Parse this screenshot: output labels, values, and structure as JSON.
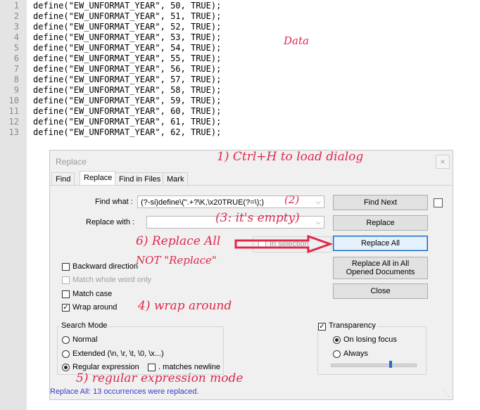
{
  "editor": {
    "lines": [
      {
        "num": "1",
        "code": "define(\"EW_UNFORMAT_YEAR\", 50, TRUE);"
      },
      {
        "num": "2",
        "code": "define(\"EW_UNFORMAT_YEAR\", 51, TRUE);"
      },
      {
        "num": "3",
        "code": "define(\"EW_UNFORMAT_YEAR\", 52, TRUE);"
      },
      {
        "num": "4",
        "code": "define(\"EW_UNFORMAT_YEAR\", 53, TRUE);"
      },
      {
        "num": "5",
        "code": "define(\"EW_UNFORMAT_YEAR\", 54, TRUE);"
      },
      {
        "num": "6",
        "code": "define(\"EW_UNFORMAT_YEAR\", 55, TRUE);"
      },
      {
        "num": "7",
        "code": "define(\"EW_UNFORMAT_YEAR\", 56, TRUE);"
      },
      {
        "num": "8",
        "code": "define(\"EW_UNFORMAT_YEAR\", 57, TRUE);"
      },
      {
        "num": "9",
        "code": "define(\"EW_UNFORMAT_YEAR\", 58, TRUE);"
      },
      {
        "num": "10",
        "code": "define(\"EW_UNFORMAT_YEAR\", 59, TRUE);"
      },
      {
        "num": "11",
        "code": "define(\"EW_UNFORMAT_YEAR\", 60, TRUE);"
      },
      {
        "num": "12",
        "code": "define(\"EW_UNFORMAT_YEAR\", 61, TRUE);"
      },
      {
        "num": "13",
        "code": "define(\"EW_UNFORMAT_YEAR\", 62, TRUE);"
      }
    ]
  },
  "annotations": {
    "data": "Data",
    "step1": "1) Ctrl+H to load dialog",
    "step2": "(2)",
    "step3": "(3: it's empty)",
    "step6a": "6) Replace All",
    "step6b": "NOT \"Replace\"",
    "step4": "4) wrap around",
    "step5": "5) regular expression mode"
  },
  "dialog": {
    "title": "Replace",
    "close": "×",
    "tabs": [
      "Find",
      "Replace",
      "Find in Files",
      "Mark"
    ],
    "find_label": "Find what :",
    "find_value": "(?-si)define\\(\".+?\\K,\\x20TRUE(?=\\);)",
    "replace_label": "Replace with :",
    "replace_value": "",
    "in_selection": "In selection",
    "buttons": {
      "find_next": "Find Next",
      "replace": "Replace",
      "replace_all": "Replace All",
      "replace_all_opened": "Replace All in All Opened Documents",
      "close": "Close"
    },
    "options": {
      "backward": "Backward direction",
      "whole_word": "Match whole word only",
      "match_case": "Match case",
      "wrap_around": "Wrap around"
    },
    "search_mode": {
      "title": "Search Mode",
      "normal": "Normal",
      "extended": "Extended (\\n, \\r, \\t, \\0, \\x...)",
      "regex": "Regular expression",
      "dot_newline": ". matches newline"
    },
    "transparency": {
      "title": "Transparency",
      "on_losing_focus": "On losing focus",
      "always": "Always"
    },
    "status": "Replace All: 13 occurrences were replaced."
  },
  "colors": {
    "annotation": "#e0284a",
    "arrow": "#e0284a",
    "status": "#3a3ac8"
  }
}
